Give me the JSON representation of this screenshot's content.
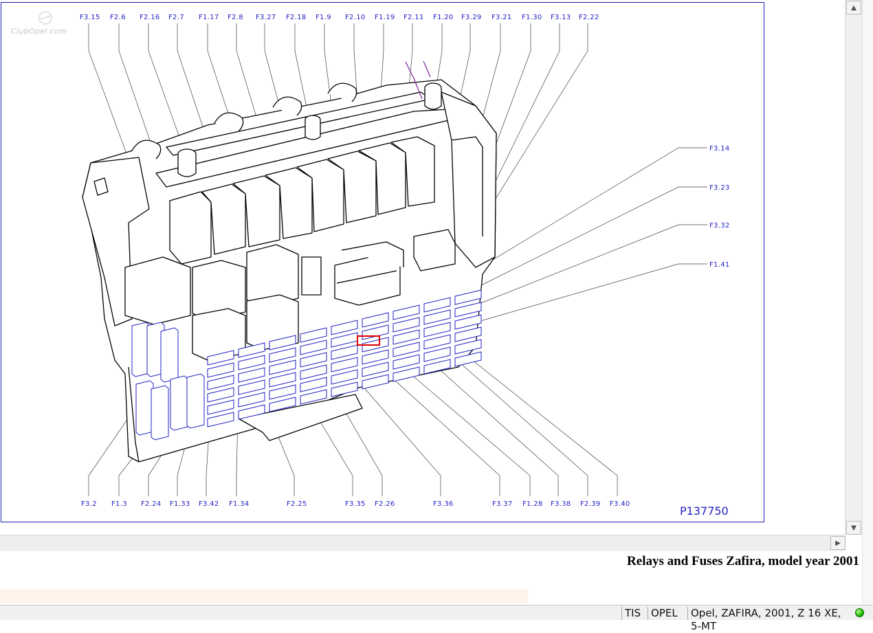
{
  "diagram": {
    "part_number": "P137750",
    "watermark": "ClubOpel.com",
    "top_labels": [
      "F3.15",
      "F2.6",
      "F2.16",
      "F2.7",
      "F1.17",
      "F2.8",
      "F3.27",
      "F2.18",
      "F1.9",
      "F2.10",
      "F1.19",
      "F2.11",
      "F1.20",
      "F3.29",
      "F3.21",
      "F1.30",
      "F3.13",
      "F2.22"
    ],
    "right_labels": [
      "F3.14",
      "F3.23",
      "F3.32",
      "F1.41"
    ],
    "bottom_labels": [
      "F3.2",
      "F1.3",
      "F2.24",
      "F1.33",
      "F3.42",
      "F1.34",
      "F2.25",
      "F3.35",
      "F2.26",
      "F3.36",
      "F3.37",
      "F1.28",
      "F3.38",
      "F2.39",
      "F3.40"
    ]
  },
  "caption": "Relays and Fuses Zafira, model year 2001",
  "statusbar": {
    "app": "TIS",
    "brand": "OPEL",
    "vehicle": "Opel, ZAFIRA, 2001, Z 16 XE, 5-MT"
  },
  "colors": {
    "label_blue": "#1f1fc4",
    "highlight_red": "#e00000",
    "status_led": "#1fb600"
  },
  "icons": [
    "scroll-up-arrow-icon",
    "scroll-down-arrow-icon",
    "scroll-right-arrow-icon",
    "status-led-icon"
  ]
}
